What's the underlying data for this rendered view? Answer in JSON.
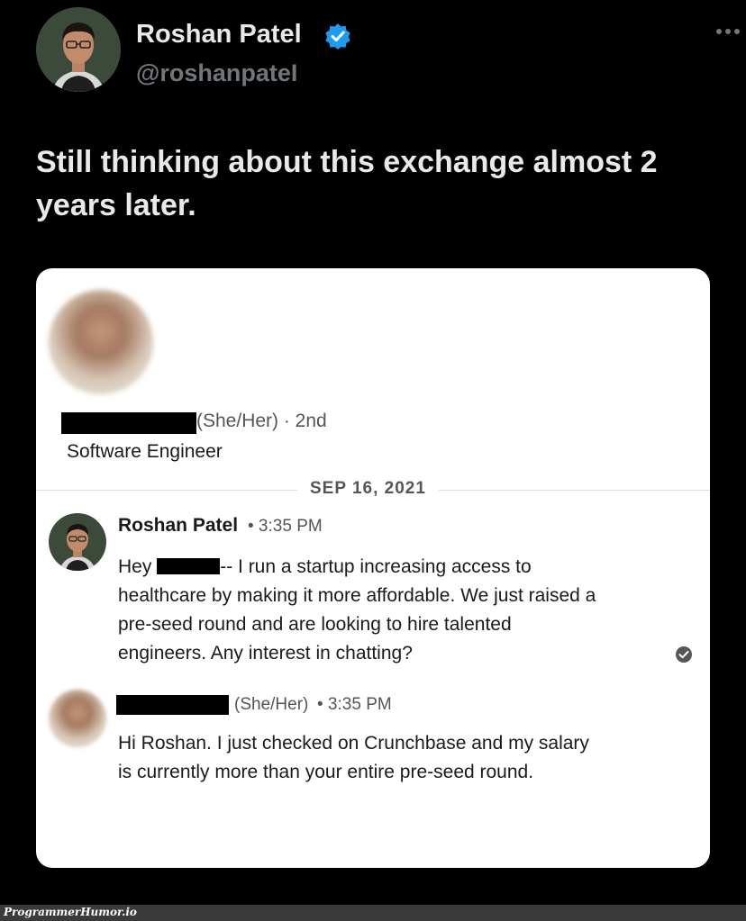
{
  "tweet": {
    "author_name": "Roshan Patel",
    "handle": "@roshanpateI",
    "text": "Still thinking about this exchange almost 2 years later.",
    "verified_color": "#1d9bf0"
  },
  "card": {
    "contact": {
      "pronoun_degree": "(She/Her) · 2nd",
      "title": "Software Engineer"
    },
    "date_separator": "SEP 16, 2021",
    "messages": [
      {
        "author": "Roshan Patel",
        "time": "• 3:35 PM",
        "body_lead": "Hey",
        "body": "-- I run a startup increasing access to healthcare by making it more affordable. We just raised a pre-seed round and are looking to hire talented engineers. Any interest in chatting?"
      },
      {
        "author_suffix": "(She/Her)",
        "time": "• 3:35 PM",
        "body": "Hi Roshan. I just checked on Crunchbase and my salary is currently more than your entire pre-seed round."
      }
    ]
  },
  "watermark": "ProgrammerHumor.io"
}
